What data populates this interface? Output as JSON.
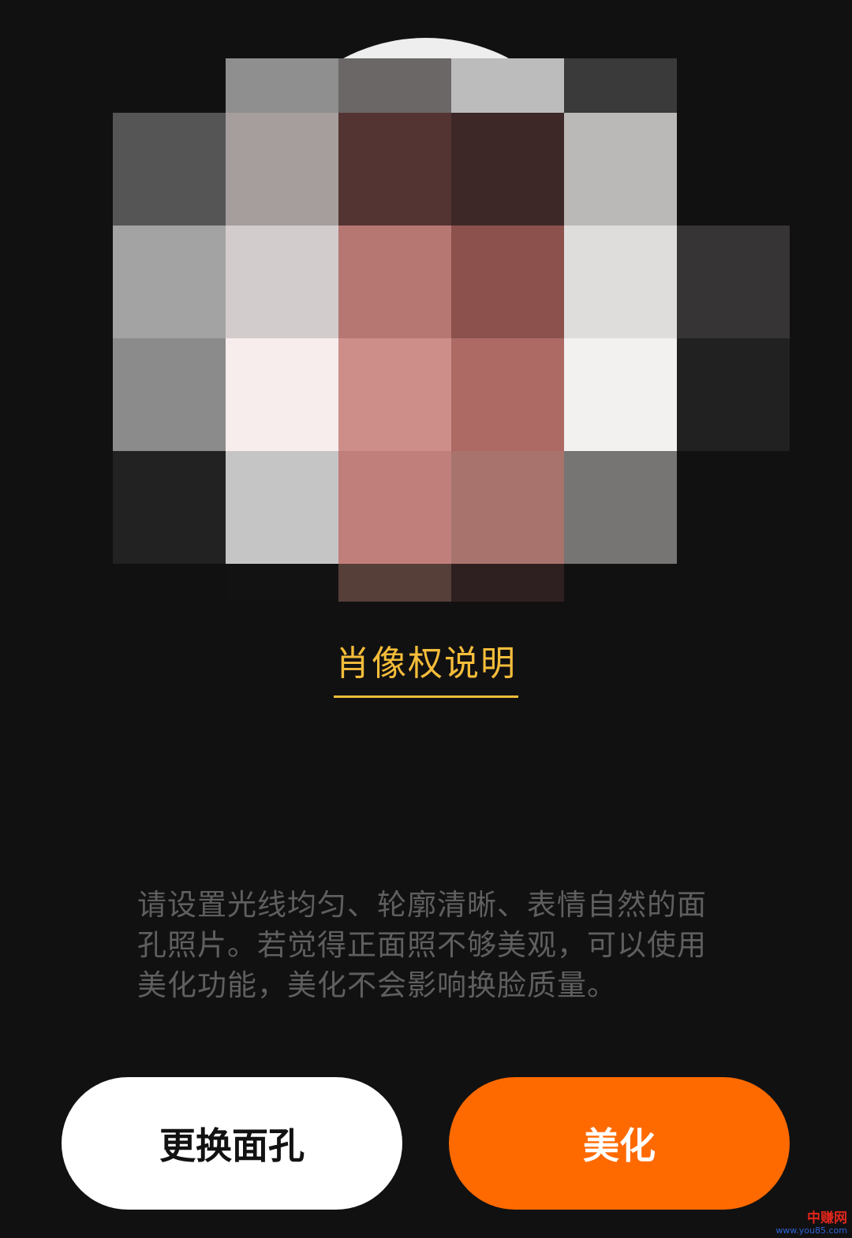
{
  "photo": {
    "description_icon": "pixelated-face-icon",
    "mosaic_colors": [
      [
        "#121112",
        "#8f8f8f",
        "#6b6767",
        "#bdbcbc",
        "#3a3a3b",
        "#121112"
      ],
      [
        "#555556",
        "#a59e9d",
        "#543433",
        "#3d2827",
        "#bab9b8",
        "#121112"
      ],
      [
        "#a3a3a3",
        "#d3cccd",
        "#b67772",
        "#8c514c",
        "#dfdcdc",
        "#363435"
      ],
      [
        "#8b8b8b",
        "#f8eded",
        "#cd8e8a",
        "#ad6a65",
        "#f2f1ef",
        "#222122"
      ],
      [
        "#232223",
        "#c6c5c5",
        "#c17f7b",
        "#a9736d",
        "#767574",
        "#121112"
      ],
      [
        "#121112",
        "#131212",
        "#563e39",
        "#2e2020",
        "#121112",
        "#121112"
      ]
    ]
  },
  "portrait_rights": {
    "label": "肖像权说明"
  },
  "hint": {
    "text": "请设置光线均匀、轮廓清晰、表情自然的面孔照片。若觉得正面照不够美观，可以使用美化功能，美化不会影响换脸质量。"
  },
  "actions": {
    "change_face_label": "更换面孔",
    "beautify_label": "美化"
  },
  "watermark": {
    "main": "中赚网",
    "sub": "www.you85.com"
  },
  "colors": {
    "background": "#121112",
    "accent_link": "#f4bd3a",
    "primary_button": "#ff6a00",
    "secondary_button": "#ffffff"
  }
}
